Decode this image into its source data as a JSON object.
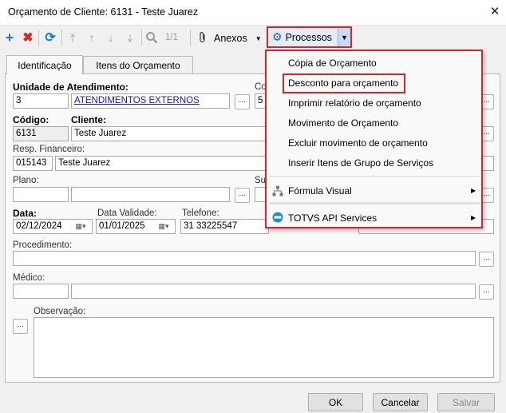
{
  "window": {
    "title": "Orçamento de Cliente: 6131 - Teste Juarez"
  },
  "toolbar": {
    "counter": "1/1",
    "anexos_label": "Anexos",
    "processos_label": "Processos"
  },
  "tabs": [
    {
      "label": "Identificação",
      "active": true
    },
    {
      "label": "Itens do Orçamento",
      "active": false
    }
  ],
  "form": {
    "unidade_label": "Unidade de Atendimento:",
    "unidade_code": "3",
    "unidade_name": "ATENDIMENTOS EXTERNOS",
    "co_label_partial": "Co",
    "co_value": "5",
    "codigo_label": "Código:",
    "codigo_value": "6131",
    "cliente_label": "Cliente:",
    "cliente_value": "Teste Juarez",
    "resp_label": "Resp. Financeiro:",
    "resp_code": "015143",
    "resp_name": "Teste Juarez",
    "plano_label": "Plano:",
    "su_label_partial": "Su",
    "data_label": "Data:",
    "data_value": "02/12/2024",
    "validade_label": "Data Validade:",
    "validade_value": "01/01/2025",
    "telefone_label": "Telefone:",
    "telefone_value": "31 33225547",
    "procedimento_label": "Procedimento:",
    "medico_label": "Médico:",
    "observacao_label": "Observação:",
    "dots": "..."
  },
  "menu": {
    "items": [
      "Cópia de Orçamento",
      "Desconto para orçamento",
      "Imprimir relatório de orçamento",
      "Movimento de Orçamento",
      "Excluir movimento de orçamento",
      "Inserir Itens de Grupo de Serviços",
      "Fórmula Visual",
      "TOTVS API Services"
    ],
    "highlighted": "Desconto para orçamento"
  },
  "footer": {
    "ok": "OK",
    "cancel": "Cancelar",
    "save": "Salvar"
  },
  "colors": {
    "accent_red": "#d9232d",
    "add_blue": "#1e7bc4",
    "delete_red": "#d02a2a",
    "link_blue": "#1a1ab0"
  }
}
